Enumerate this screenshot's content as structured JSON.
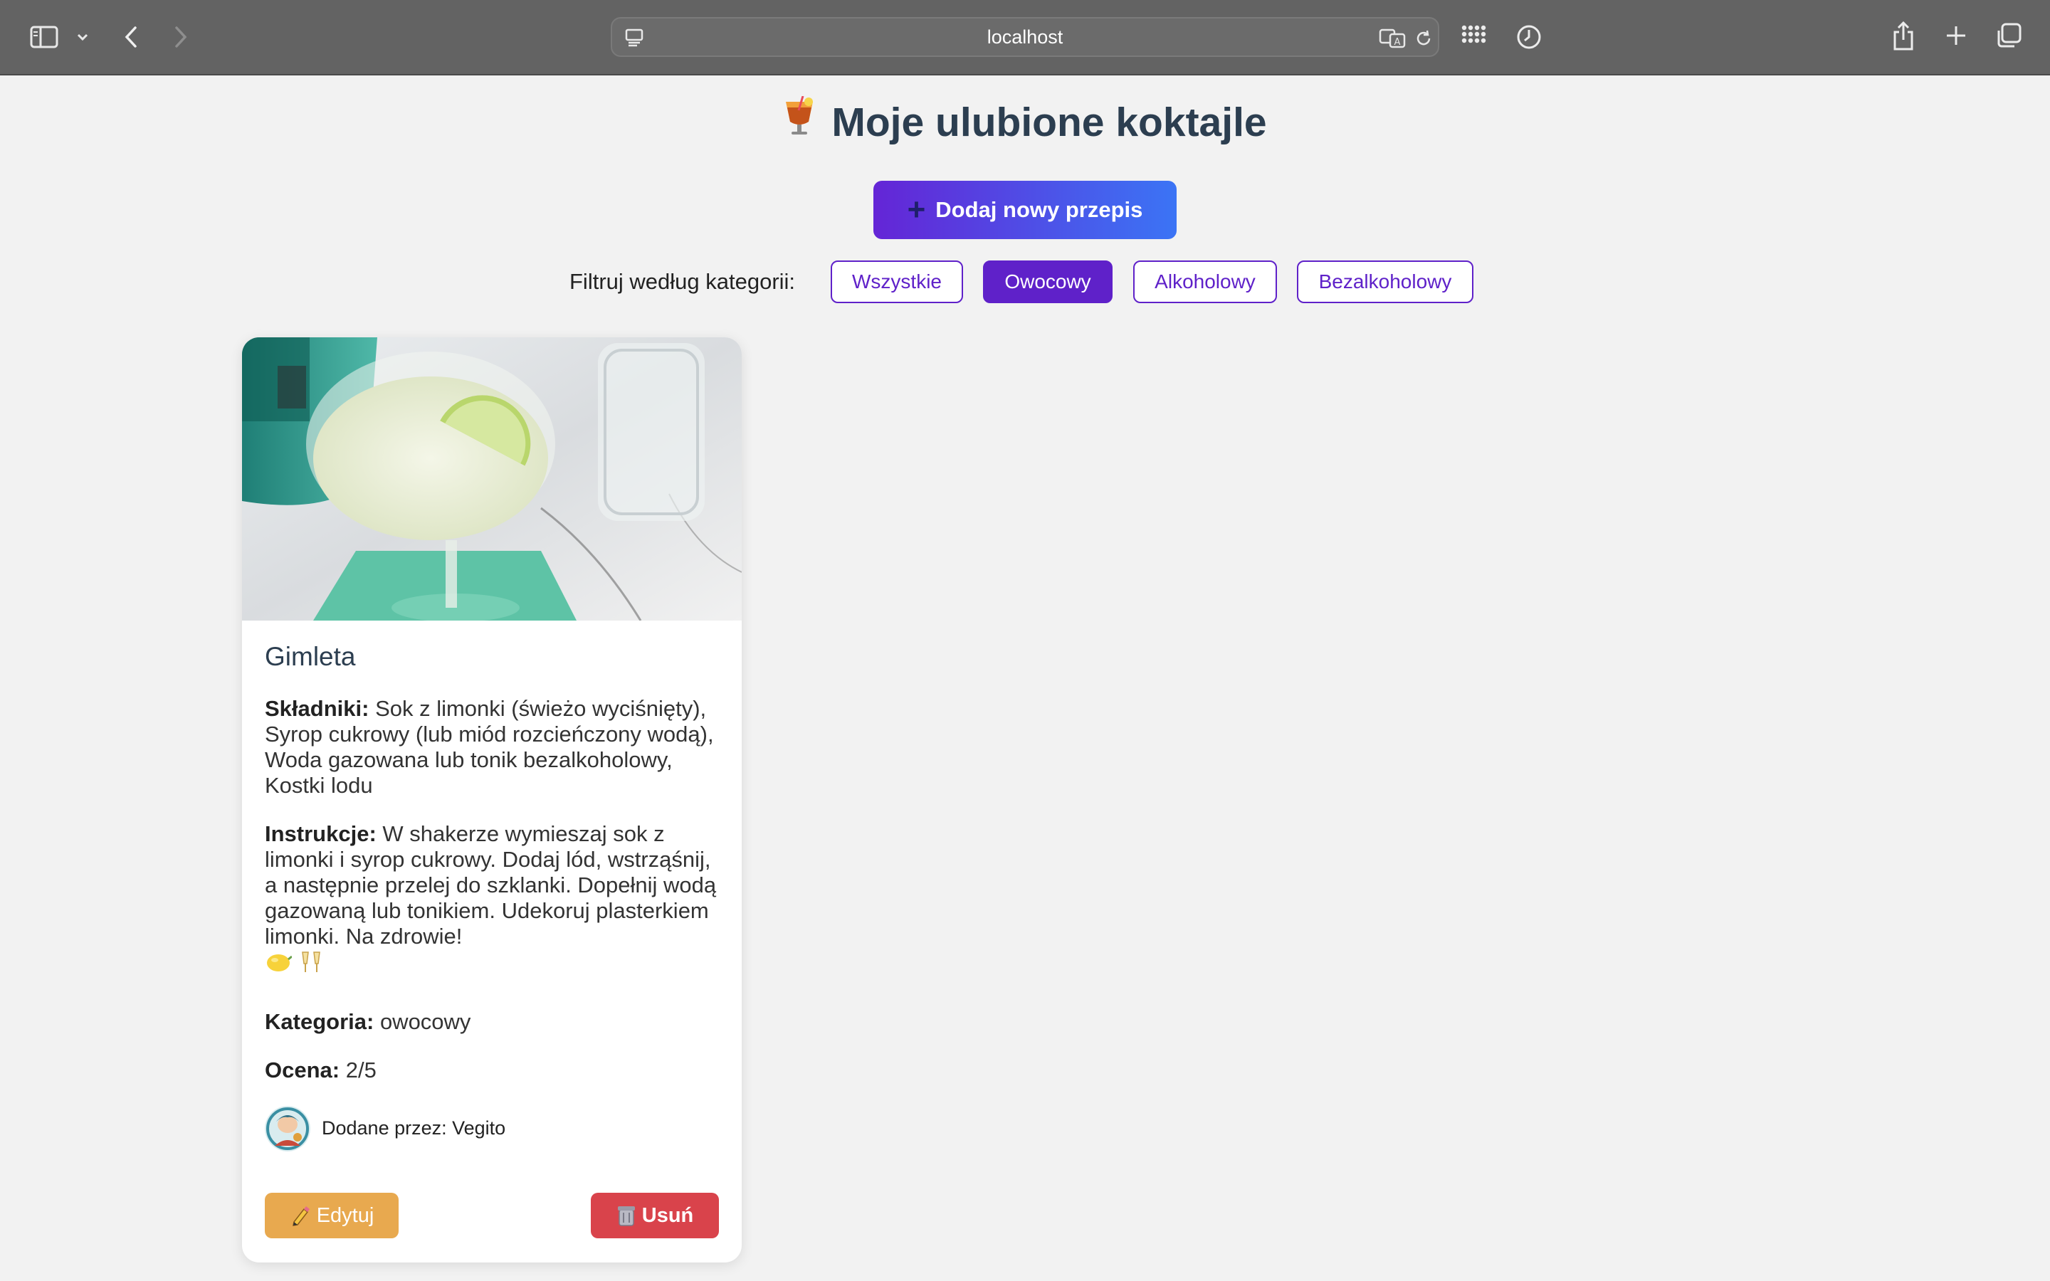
{
  "browser": {
    "url": "localhost",
    "icons": [
      "sidebar-icon",
      "chevron-down-icon",
      "back-icon",
      "forward-icon",
      "page-icon",
      "translate-icon",
      "reload-icon",
      "grid-icon",
      "history-icon",
      "share-icon",
      "plus-icon",
      "tabs-icon"
    ]
  },
  "page": {
    "title": "Moje ulubione koktajle",
    "add_button": "Dodaj nowy przepis",
    "filter_label": "Filtruj według kategorii:",
    "filters": [
      "Wszystkie",
      "Owocowy",
      "Alkoholowy",
      "Bezalkoholowy"
    ],
    "active_filter": "Owocowy"
  },
  "card": {
    "name": "Gimleta",
    "ingredients_label": "Składniki:",
    "ingredients": "Sok z limonki (świeżo wyciśnięty), Syrop cukrowy (lub miód rozcieńczony wodą), Woda gazowana lub tonik bezalkoholowy, Kostki lodu",
    "instructions_label": "Instrukcje:",
    "instructions": "W shakerze wymieszaj sok z limonki i syrop cukrowy. Dodaj lód, wstrząśnij, a następnie przelej do szklanki. Dopełnij wodą gazowaną lub tonikiem. Udekoruj plasterkiem limonki. Na zdrowie!",
    "category_label": "Kategoria:",
    "category": "owocowy",
    "rating_label": "Ocena:",
    "rating": "2/5",
    "author": "Dodane przez: Vegito",
    "edit_button": "Edytuj",
    "delete_button": "Usuń"
  },
  "colors": {
    "accent": "#5f21c9",
    "gradient_start": "#6425d6",
    "gradient_end": "#3b74f5",
    "edit": "#e8a94f",
    "delete": "#d9434b",
    "title": "#2c3e50"
  }
}
